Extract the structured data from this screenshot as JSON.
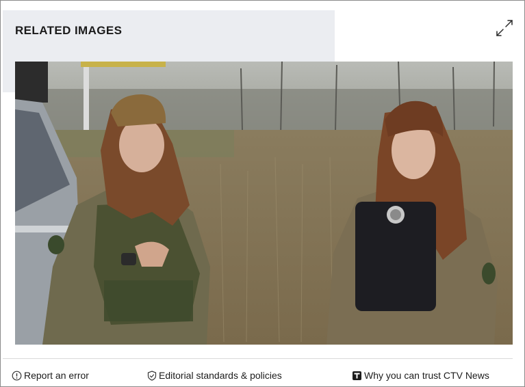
{
  "section": {
    "title": "RELATED IMAGES"
  },
  "icons": {
    "expand": "expand-arrows-icon",
    "report": "info-circle-icon",
    "editorial": "shield-check-icon",
    "trust": "trust-t-icon"
  },
  "footer": {
    "report_label": "Report an error",
    "editorial_label": "Editorial standards & policies",
    "trust_label": "Why you can trust CTV News"
  },
  "colors": {
    "panel_bg": "#ebedf1",
    "text": "#1b1b1b",
    "border": "#8a8a8a",
    "divider": "#d9d9d9"
  }
}
